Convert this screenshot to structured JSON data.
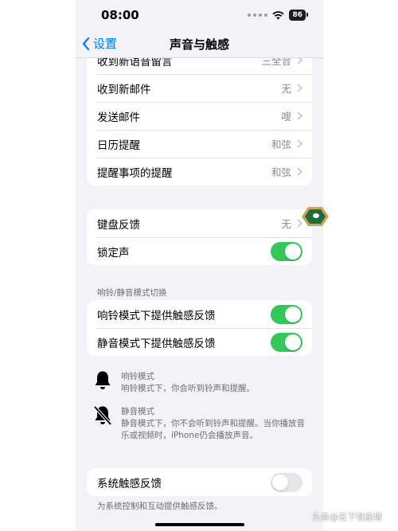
{
  "status": {
    "time": "08:00",
    "battery": "86"
  },
  "nav": {
    "back_label": "设置",
    "title": "声音与触感"
  },
  "group1": [
    {
      "label": "收到新语音留言",
      "value": "三全音"
    },
    {
      "label": "收到新邮件",
      "value": "无"
    },
    {
      "label": "发送邮件",
      "value": "嗖"
    },
    {
      "label": "日历提醒",
      "value": "和弦"
    },
    {
      "label": "提醒事项的提醒",
      "value": "和弦"
    }
  ],
  "group2": {
    "keyboard_feedback": {
      "label": "键盘反馈",
      "value": "无"
    },
    "lock_sound": {
      "label": "锁定声",
      "on": true
    }
  },
  "ring_silent_section": {
    "header": "响铃/静音模式切换",
    "ring_haptics": {
      "label": "响铃模式下提供触感反馈",
      "on": true
    },
    "silent_haptics": {
      "label": "静音模式下提供触感反馈",
      "on": true
    }
  },
  "info": {
    "ring": {
      "icon": "bell-icon",
      "title": "响铃模式",
      "desc": "响铃模式下，你会听到铃声和提醒。"
    },
    "silent": {
      "icon": "bell-slash-icon",
      "title": "静音模式",
      "desc": "静音模式下，你不会听到铃声和提醒。当你播放音乐或视频时，iPhone仍会播放声音。"
    }
  },
  "system_haptics": {
    "label": "系统触感反馈",
    "on": false,
    "footer": "为系统控制和互动提供触感反馈。"
  },
  "watermark": "头条@云下有座塔",
  "colors": {
    "accent": "#007aff",
    "toggle_on": "#34c759",
    "background": "#f2f2f7"
  }
}
